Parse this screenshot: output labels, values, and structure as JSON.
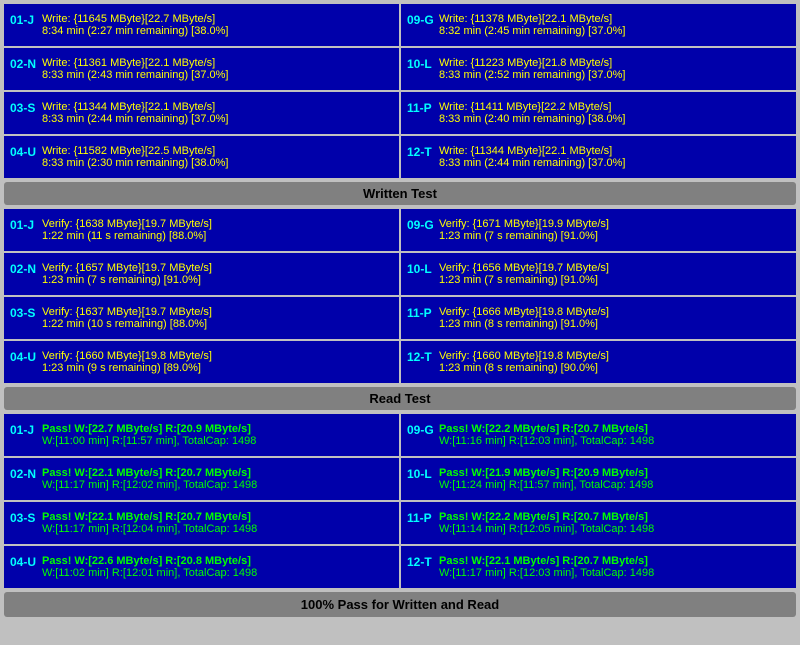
{
  "sections": {
    "write": {
      "header": "Written Test",
      "rows": [
        {
          "left": {
            "label": "01-J",
            "line1": "Write: {11645 MByte}[22.7 MByte/s]",
            "line2": "8:34 min (2:27 min remaining)  [38.0%]"
          },
          "right": {
            "label": "09-G",
            "line1": "Write: {11378 MByte}[22.1 MByte/s]",
            "line2": "8:32 min (2:45 min remaining)  [37.0%]"
          }
        },
        {
          "left": {
            "label": "02-N",
            "line1": "Write: {11361 MByte}[22.1 MByte/s]",
            "line2": "8:33 min (2:43 min remaining)  [37.0%]"
          },
          "right": {
            "label": "10-L",
            "line1": "Write: {11223 MByte}[21.8 MByte/s]",
            "line2": "8:33 min (2:52 min remaining)  [37.0%]"
          }
        },
        {
          "left": {
            "label": "03-S",
            "line1": "Write: {11344 MByte}[22.1 MByte/s]",
            "line2": "8:33 min (2:44 min remaining)  [37.0%]"
          },
          "right": {
            "label": "11-P",
            "line1": "Write: {11411 MByte}[22.2 MByte/s]",
            "line2": "8:33 min (2:40 min remaining)  [38.0%]"
          }
        },
        {
          "left": {
            "label": "04-U",
            "line1": "Write: {11582 MByte}[22.5 MByte/s]",
            "line2": "8:33 min (2:30 min remaining)  [38.0%]"
          },
          "right": {
            "label": "12-T",
            "line1": "Write: {11344 MByte}[22.1 MByte/s]",
            "line2": "8:33 min (2:44 min remaining)  [37.0%]"
          }
        }
      ]
    },
    "verify": {
      "rows": [
        {
          "left": {
            "label": "01-J",
            "line1": "Verify: {1638 MByte}[19.7 MByte/s]",
            "line2": "1:22 min (11 s remaining)   [88.0%]"
          },
          "right": {
            "label": "09-G",
            "line1": "Verify: {1671 MByte}[19.9 MByte/s]",
            "line2": "1:23 min (7 s remaining)   [91.0%]"
          }
        },
        {
          "left": {
            "label": "02-N",
            "line1": "Verify: {1657 MByte}[19.7 MByte/s]",
            "line2": "1:23 min (7 s remaining)   [91.0%]"
          },
          "right": {
            "label": "10-L",
            "line1": "Verify: {1656 MByte}[19.7 MByte/s]",
            "line2": "1:23 min (7 s remaining)   [91.0%]"
          }
        },
        {
          "left": {
            "label": "03-S",
            "line1": "Verify: {1637 MByte}[19.7 MByte/s]",
            "line2": "1:22 min (10 s remaining)   [88.0%]"
          },
          "right": {
            "label": "11-P",
            "line1": "Verify: {1666 MByte}[19.8 MByte/s]",
            "line2": "1:23 min (8 s remaining)   [91.0%]"
          }
        },
        {
          "left": {
            "label": "04-U",
            "line1": "Verify: {1660 MByte}[19.8 MByte/s]",
            "line2": "1:23 min (9 s remaining)   [89.0%]"
          },
          "right": {
            "label": "12-T",
            "line1": "Verify: {1660 MByte}[19.8 MByte/s]",
            "line2": "1:23 min (8 s remaining)   [90.0%]"
          }
        }
      ]
    },
    "read": {
      "header": "Read Test",
      "rows": [
        {
          "left": {
            "label": "01-J",
            "line1": "Pass! W:[22.7 MByte/s] R:[20.9 MByte/s]",
            "line2": "W:[11:00 min] R:[11:57 min], TotalCap: 1498"
          },
          "right": {
            "label": "09-G",
            "line1": "Pass! W:[22.2 MByte/s] R:[20.7 MByte/s]",
            "line2": "W:[11:16 min] R:[12:03 min], TotalCap: 1498"
          }
        },
        {
          "left": {
            "label": "02-N",
            "line1": "Pass! W:[22.1 MByte/s] R:[20.7 MByte/s]",
            "line2": "W:[11:17 min] R:[12:02 min], TotalCap: 1498"
          },
          "right": {
            "label": "10-L",
            "line1": "Pass! W:[21.9 MByte/s] R:[20.9 MByte/s]",
            "line2": "W:[11:24 min] R:[11:57 min], TotalCap: 1498"
          }
        },
        {
          "left": {
            "label": "03-S",
            "line1": "Pass! W:[22.1 MByte/s] R:[20.7 MByte/s]",
            "line2": "W:[11:17 min] R:[12:04 min], TotalCap: 1498"
          },
          "right": {
            "label": "11-P",
            "line1": "Pass! W:[22.2 MByte/s] R:[20.7 MByte/s]",
            "line2": "W:[11:14 min] R:[12:05 min], TotalCap: 1498"
          }
        },
        {
          "left": {
            "label": "04-U",
            "line1": "Pass! W:[22.6 MByte/s] R:[20.8 MByte/s]",
            "line2": "W:[11:02 min] R:[12:01 min], TotalCap: 1498"
          },
          "right": {
            "label": "12-T",
            "line1": "Pass! W:[22.1 MByte/s] R:[20.7 MByte/s]",
            "line2": "W:[11:17 min] R:[12:03 min], TotalCap: 1498"
          }
        }
      ]
    },
    "footer": "100% Pass for Written and Read",
    "write_header": "Written Test",
    "read_header": "Read Test"
  }
}
